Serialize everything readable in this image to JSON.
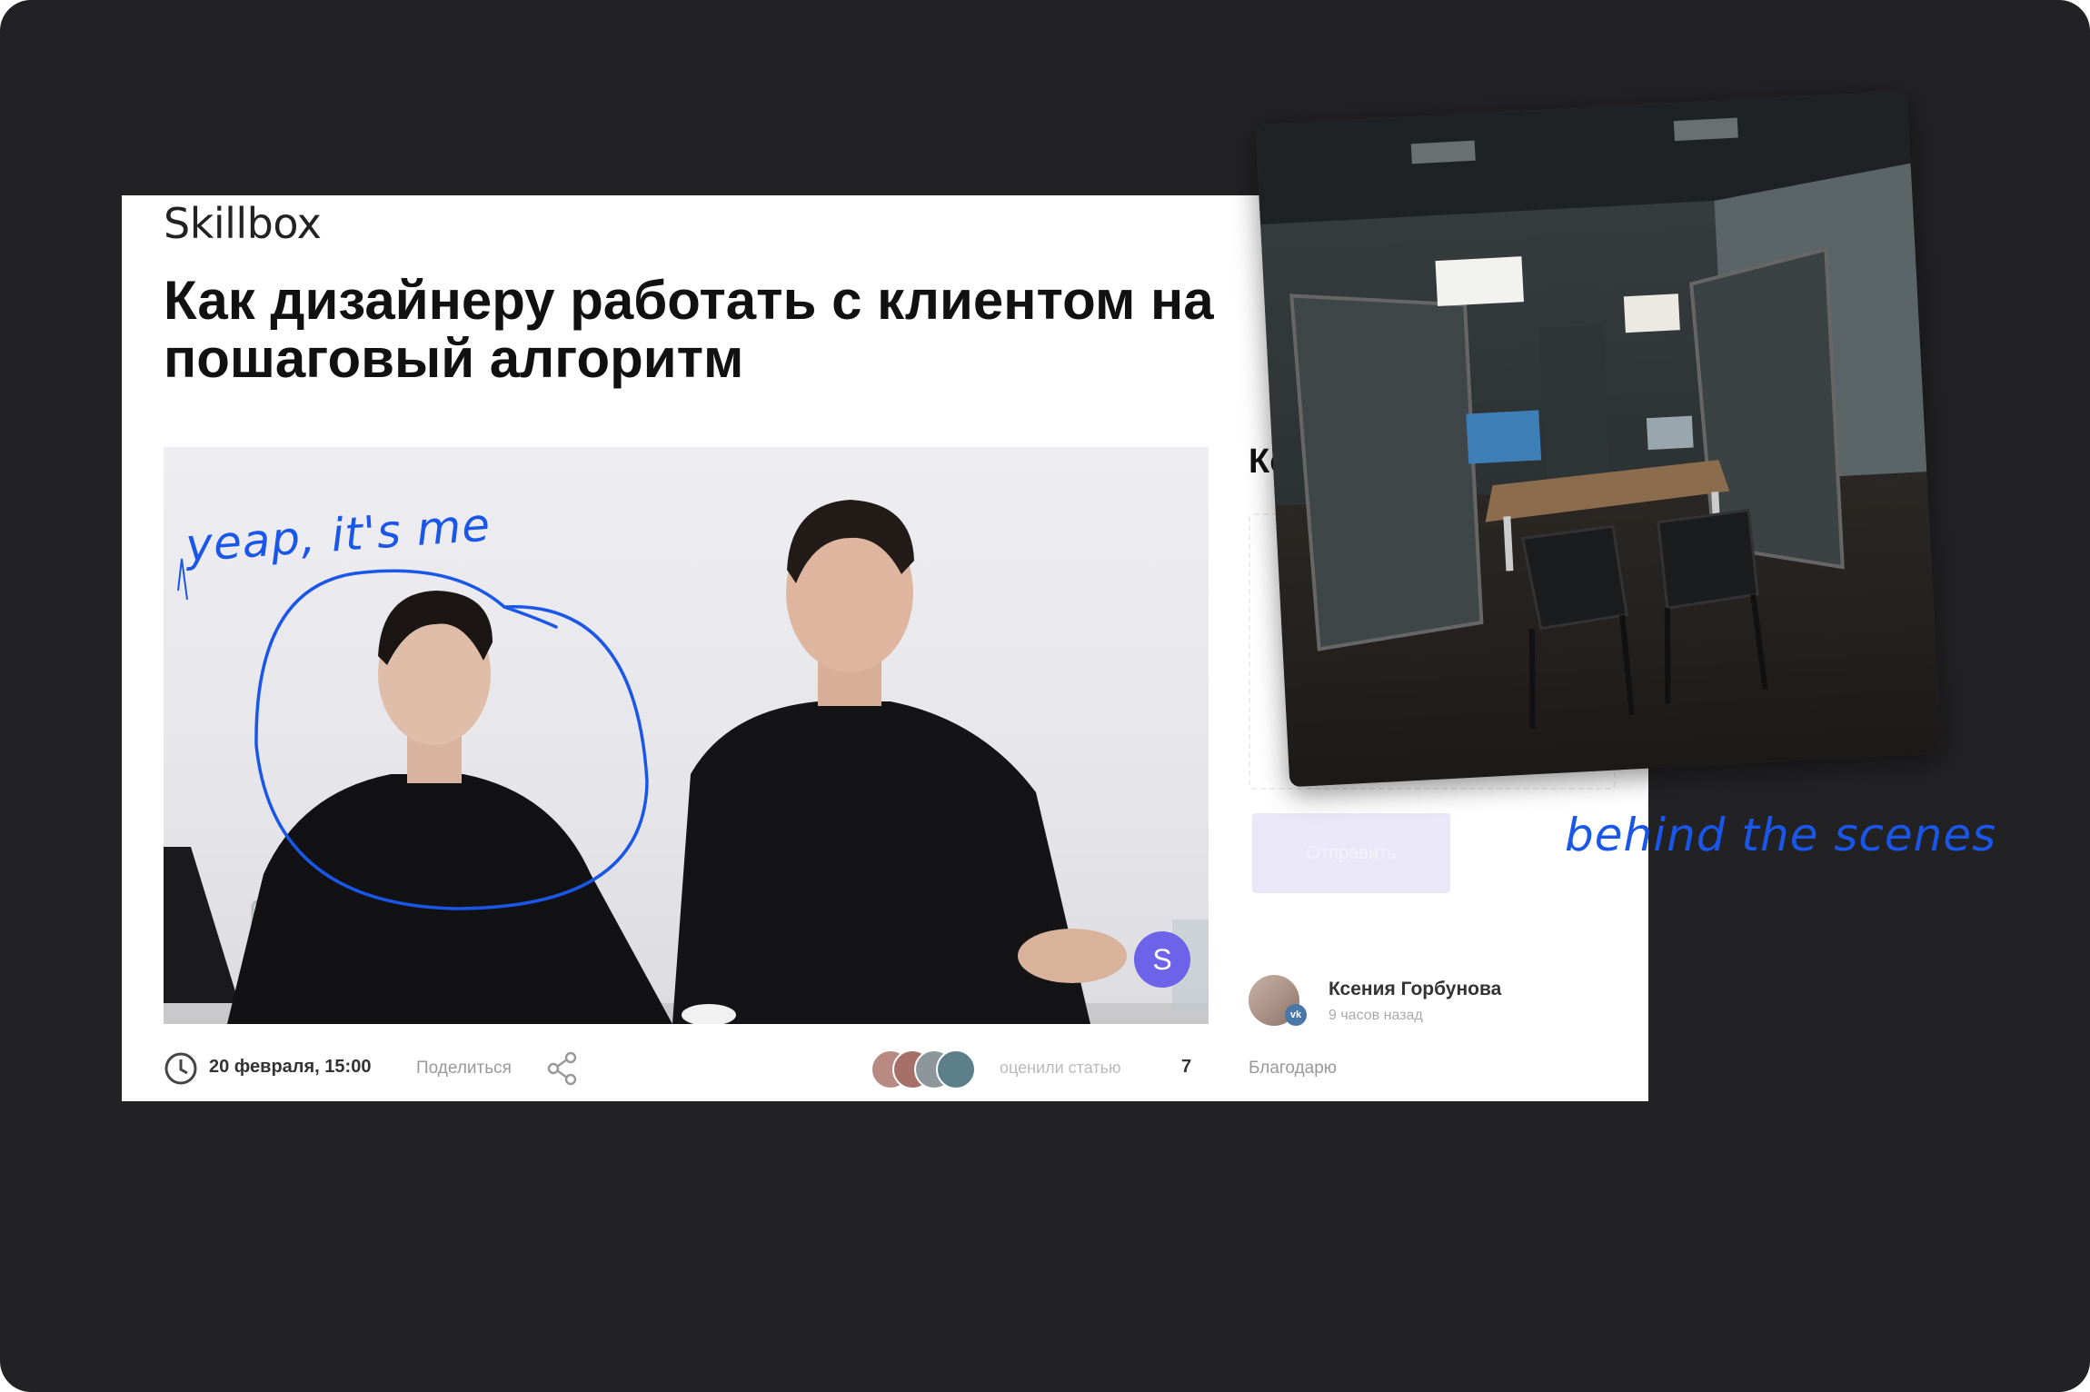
{
  "article": {
    "logo": "Skillbox",
    "headline_line1": "Как дизайнеру работать с клиентом на",
    "headline_line2": "пошаговый алгоритм",
    "video": {
      "play_badge": "S"
    },
    "meta": {
      "date": "20 февраля, 15:00",
      "share_label": "Поделиться",
      "reactions_label": "оценили статью",
      "reactions_count": "7"
    },
    "sidebar": {
      "heading": "Ко",
      "button_label": "Отправить",
      "author_name": "Ксения Горбунова",
      "author_time": "9 часов назад",
      "vk_badge": "vk",
      "thanks_label": "Благодарю"
    }
  },
  "annotations": {
    "me": "yeap, it's me",
    "behind": "behind the scenes"
  },
  "colors": {
    "background": "#222224",
    "annotation": "#1a57e8",
    "accent": "#6c63e8"
  }
}
